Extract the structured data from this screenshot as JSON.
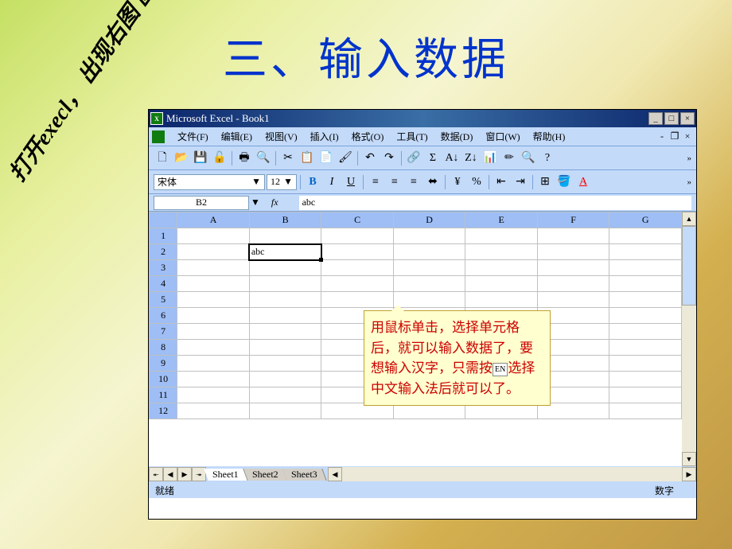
{
  "slide": {
    "title": "三、输入数据",
    "side_note": "打开execl，\n出现右图\n画面。"
  },
  "titlebar": {
    "app": "Microsoft Excel - Book1",
    "icon_text": "X"
  },
  "menubar": {
    "file": "文件(F)",
    "edit": "编辑(E)",
    "view": "视图(V)",
    "insert": "插入(I)",
    "format": "格式(O)",
    "tools": "工具(T)",
    "data": "数据(D)",
    "window": "窗口(W)",
    "help": "帮助(H)"
  },
  "format": {
    "font_name": "宋体",
    "font_size": "12"
  },
  "formula": {
    "cell_ref": "B2",
    "fx": "fx",
    "value": "abc"
  },
  "grid": {
    "columns": [
      "A",
      "B",
      "C",
      "D",
      "E",
      "F",
      "G"
    ],
    "rows": [
      "1",
      "2",
      "3",
      "4",
      "5",
      "6",
      "7",
      "8",
      "9",
      "10",
      "11",
      "12"
    ],
    "active_cell_value": "abc",
    "active_row": "2",
    "active_col": "B"
  },
  "sheets": {
    "sheet1": "Sheet1",
    "sheet2": "Sheet2",
    "sheet3": "Sheet3"
  },
  "status": {
    "ready": "就绪",
    "num": "数字"
  },
  "callout": {
    "text1": "用鼠标单击，选择单元格后，就可以输入数据了，要想输入汉字，只需按",
    "ime": "EN",
    "text2": "选择中文输入法后就可以了。"
  }
}
